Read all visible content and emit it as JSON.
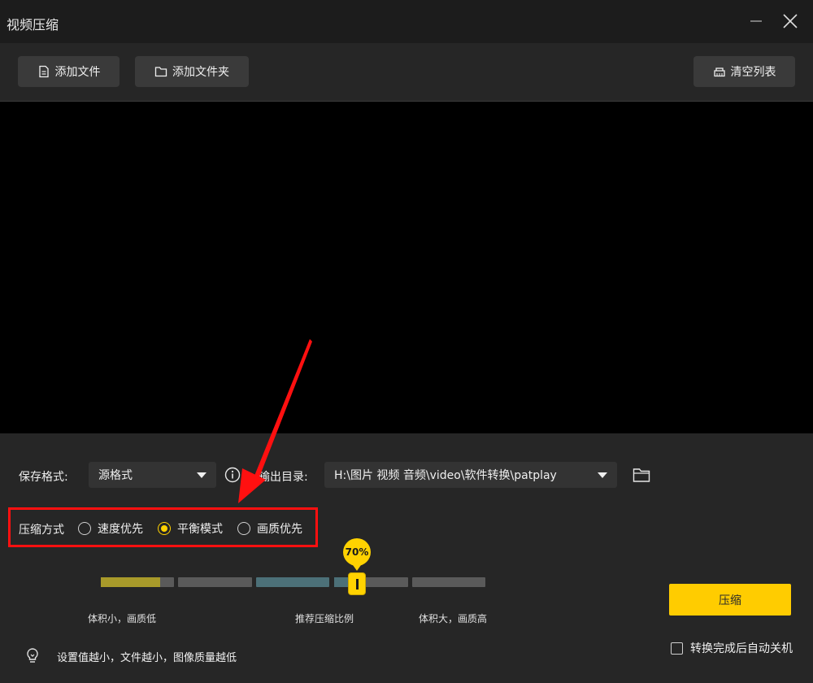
{
  "window": {
    "title": "视频压缩",
    "minimize_icon": "minimize-icon",
    "close_icon": "close-icon"
  },
  "toolbar": {
    "add_file_label": "添加文件",
    "add_folder_label": "添加文件夹",
    "clear_list_label": "清空列表"
  },
  "settings": {
    "format_label": "保存格式:",
    "format_value": "源格式",
    "output_dir_label": "输出目录:",
    "output_dir_value": "H:\\图片 视频 音频\\video\\软件转换\\patplay"
  },
  "compression": {
    "mode_label": "压缩方式",
    "modes": [
      {
        "label": "速度优先",
        "selected": false
      },
      {
        "label": "平衡模式",
        "selected": true
      },
      {
        "label": "画质优先",
        "selected": false
      }
    ],
    "value_percent": 70,
    "value_label": "70%",
    "hint_low": "体积小，画质低",
    "hint_recommended": "推荐压缩比例",
    "hint_high": "体积大，画质高",
    "tip": "设置值越小，文件越小，图像质量越低"
  },
  "actions": {
    "compress_label": "压缩",
    "shutdown_label": "转换完成后自动关机",
    "shutdown_checked": false
  },
  "colors": {
    "accent": "#ffcc00",
    "highlight": "#ff1010"
  }
}
